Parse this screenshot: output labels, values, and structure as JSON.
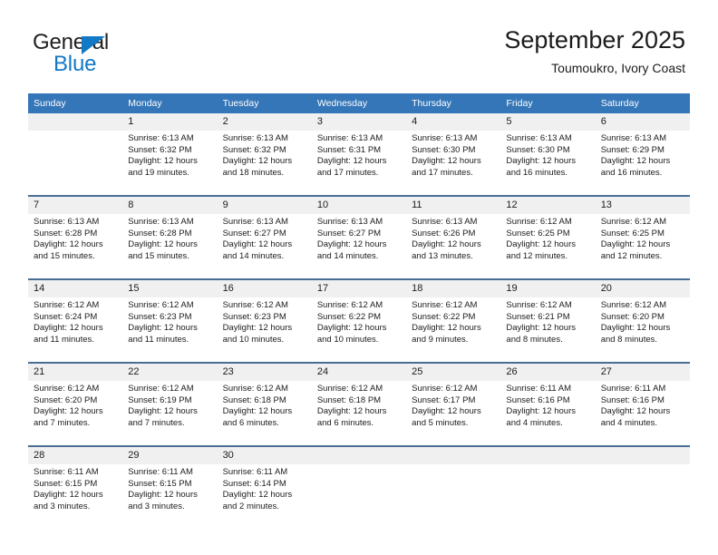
{
  "brand": {
    "name_part1": "General",
    "name_part2": "Blue",
    "triangle_color": "#1279c6",
    "text_color": "#212121"
  },
  "header": {
    "title": "September 2025",
    "subtitle": "Toumoukro, Ivory Coast",
    "accent_color": "#3576b8",
    "daynum_band_color": "#f0f0f0",
    "row_divider_color": "#4a6e93"
  },
  "calendar": {
    "weekday_headers": [
      "Sunday",
      "Monday",
      "Tuesday",
      "Wednesday",
      "Thursday",
      "Friday",
      "Saturday"
    ],
    "weeks": [
      [
        {
          "day": "",
          "lines": []
        },
        {
          "day": "1",
          "lines": [
            "Sunrise: 6:13 AM",
            "Sunset: 6:32 PM",
            "Daylight: 12 hours",
            "and 19 minutes."
          ]
        },
        {
          "day": "2",
          "lines": [
            "Sunrise: 6:13 AM",
            "Sunset: 6:32 PM",
            "Daylight: 12 hours",
            "and 18 minutes."
          ]
        },
        {
          "day": "3",
          "lines": [
            "Sunrise: 6:13 AM",
            "Sunset: 6:31 PM",
            "Daylight: 12 hours",
            "and 17 minutes."
          ]
        },
        {
          "day": "4",
          "lines": [
            "Sunrise: 6:13 AM",
            "Sunset: 6:30 PM",
            "Daylight: 12 hours",
            "and 17 minutes."
          ]
        },
        {
          "day": "5",
          "lines": [
            "Sunrise: 6:13 AM",
            "Sunset: 6:30 PM",
            "Daylight: 12 hours",
            "and 16 minutes."
          ]
        },
        {
          "day": "6",
          "lines": [
            "Sunrise: 6:13 AM",
            "Sunset: 6:29 PM",
            "Daylight: 12 hours",
            "and 16 minutes."
          ]
        }
      ],
      [
        {
          "day": "7",
          "lines": [
            "Sunrise: 6:13 AM",
            "Sunset: 6:28 PM",
            "Daylight: 12 hours",
            "and 15 minutes."
          ]
        },
        {
          "day": "8",
          "lines": [
            "Sunrise: 6:13 AM",
            "Sunset: 6:28 PM",
            "Daylight: 12 hours",
            "and 15 minutes."
          ]
        },
        {
          "day": "9",
          "lines": [
            "Sunrise: 6:13 AM",
            "Sunset: 6:27 PM",
            "Daylight: 12 hours",
            "and 14 minutes."
          ]
        },
        {
          "day": "10",
          "lines": [
            "Sunrise: 6:13 AM",
            "Sunset: 6:27 PM",
            "Daylight: 12 hours",
            "and 14 minutes."
          ]
        },
        {
          "day": "11",
          "lines": [
            "Sunrise: 6:13 AM",
            "Sunset: 6:26 PM",
            "Daylight: 12 hours",
            "and 13 minutes."
          ]
        },
        {
          "day": "12",
          "lines": [
            "Sunrise: 6:12 AM",
            "Sunset: 6:25 PM",
            "Daylight: 12 hours",
            "and 12 minutes."
          ]
        },
        {
          "day": "13",
          "lines": [
            "Sunrise: 6:12 AM",
            "Sunset: 6:25 PM",
            "Daylight: 12 hours",
            "and 12 minutes."
          ]
        }
      ],
      [
        {
          "day": "14",
          "lines": [
            "Sunrise: 6:12 AM",
            "Sunset: 6:24 PM",
            "Daylight: 12 hours",
            "and 11 minutes."
          ]
        },
        {
          "day": "15",
          "lines": [
            "Sunrise: 6:12 AM",
            "Sunset: 6:23 PM",
            "Daylight: 12 hours",
            "and 11 minutes."
          ]
        },
        {
          "day": "16",
          "lines": [
            "Sunrise: 6:12 AM",
            "Sunset: 6:23 PM",
            "Daylight: 12 hours",
            "and 10 minutes."
          ]
        },
        {
          "day": "17",
          "lines": [
            "Sunrise: 6:12 AM",
            "Sunset: 6:22 PM",
            "Daylight: 12 hours",
            "and 10 minutes."
          ]
        },
        {
          "day": "18",
          "lines": [
            "Sunrise: 6:12 AM",
            "Sunset: 6:22 PM",
            "Daylight: 12 hours",
            "and 9 minutes."
          ]
        },
        {
          "day": "19",
          "lines": [
            "Sunrise: 6:12 AM",
            "Sunset: 6:21 PM",
            "Daylight: 12 hours",
            "and 8 minutes."
          ]
        },
        {
          "day": "20",
          "lines": [
            "Sunrise: 6:12 AM",
            "Sunset: 6:20 PM",
            "Daylight: 12 hours",
            "and 8 minutes."
          ]
        }
      ],
      [
        {
          "day": "21",
          "lines": [
            "Sunrise: 6:12 AM",
            "Sunset: 6:20 PM",
            "Daylight: 12 hours",
            "and 7 minutes."
          ]
        },
        {
          "day": "22",
          "lines": [
            "Sunrise: 6:12 AM",
            "Sunset: 6:19 PM",
            "Daylight: 12 hours",
            "and 7 minutes."
          ]
        },
        {
          "day": "23",
          "lines": [
            "Sunrise: 6:12 AM",
            "Sunset: 6:18 PM",
            "Daylight: 12 hours",
            "and 6 minutes."
          ]
        },
        {
          "day": "24",
          "lines": [
            "Sunrise: 6:12 AM",
            "Sunset: 6:18 PM",
            "Daylight: 12 hours",
            "and 6 minutes."
          ]
        },
        {
          "day": "25",
          "lines": [
            "Sunrise: 6:12 AM",
            "Sunset: 6:17 PM",
            "Daylight: 12 hours",
            "and 5 minutes."
          ]
        },
        {
          "day": "26",
          "lines": [
            "Sunrise: 6:11 AM",
            "Sunset: 6:16 PM",
            "Daylight: 12 hours",
            "and 4 minutes."
          ]
        },
        {
          "day": "27",
          "lines": [
            "Sunrise: 6:11 AM",
            "Sunset: 6:16 PM",
            "Daylight: 12 hours",
            "and 4 minutes."
          ]
        }
      ],
      [
        {
          "day": "28",
          "lines": [
            "Sunrise: 6:11 AM",
            "Sunset: 6:15 PM",
            "Daylight: 12 hours",
            "and 3 minutes."
          ]
        },
        {
          "day": "29",
          "lines": [
            "Sunrise: 6:11 AM",
            "Sunset: 6:15 PM",
            "Daylight: 12 hours",
            "and 3 minutes."
          ]
        },
        {
          "day": "30",
          "lines": [
            "Sunrise: 6:11 AM",
            "Sunset: 6:14 PM",
            "Daylight: 12 hours",
            "and 2 minutes."
          ]
        },
        {
          "day": "",
          "lines": []
        },
        {
          "day": "",
          "lines": []
        },
        {
          "day": "",
          "lines": []
        },
        {
          "day": "",
          "lines": []
        }
      ]
    ]
  }
}
